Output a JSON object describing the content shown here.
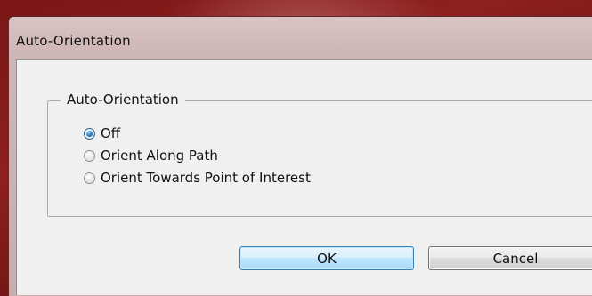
{
  "window": {
    "title": "Auto-Orientation"
  },
  "group": {
    "label": "Auto-Orientation",
    "options": [
      {
        "label": "Off",
        "selected": true
      },
      {
        "label": "Orient Along Path",
        "selected": false
      },
      {
        "label": "Orient Towards Point of Interest",
        "selected": false
      }
    ]
  },
  "buttons": {
    "ok_label": "OK",
    "cancel_label": "Cancel"
  },
  "colors": {
    "desktop_red": "#7a1616",
    "dialog_face": "#f0f0f0",
    "default_button_border": "#3c7fb1",
    "radio_selected": "#1f78c1"
  }
}
